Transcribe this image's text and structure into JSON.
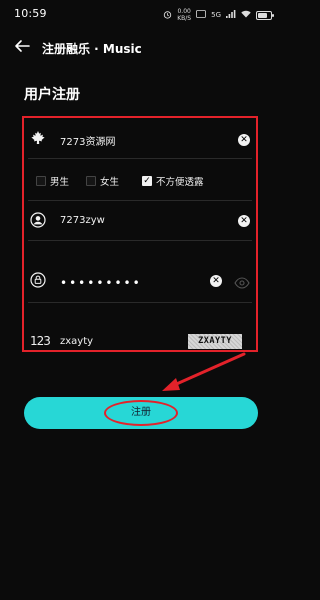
{
  "status": {
    "time": "10:59",
    "speed_value": "0.00",
    "speed_unit": "KB/S",
    "network": "5G",
    "battery_level": 0.75
  },
  "header": {
    "title": "注册融乐 · Music"
  },
  "page": {
    "section_title": "用户注册"
  },
  "form": {
    "nickname": "7273资源网",
    "gender_options": [
      {
        "label": "男生",
        "checked": false
      },
      {
        "label": "女生",
        "checked": false
      },
      {
        "label": "不方便透露",
        "checked": true
      }
    ],
    "username": "7273zyw",
    "password_mask": "•••••••••",
    "captcha_prefix": "123",
    "captcha_input": "zxayty",
    "captcha_image_text": "ZXAYTY"
  },
  "actions": {
    "register_label": "注册"
  },
  "colors": {
    "accent": "#27d7d6",
    "annotation": "#e3222a",
    "background": "#0b0b0b"
  }
}
